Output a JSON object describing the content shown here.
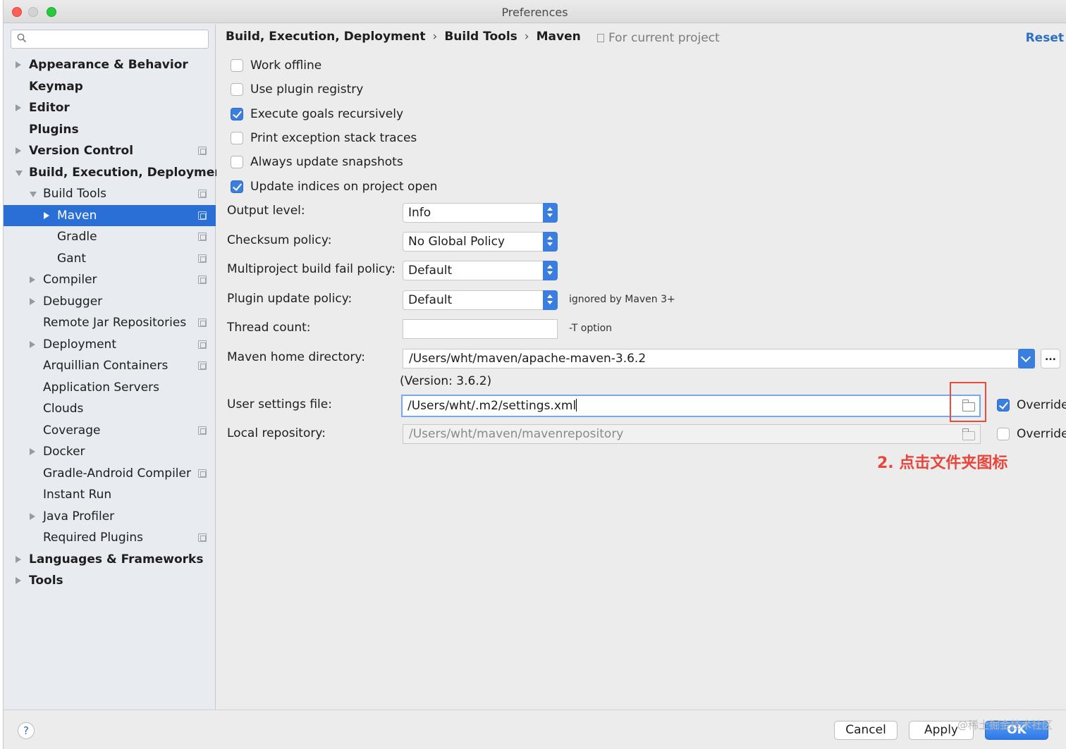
{
  "window": {
    "title": "Preferences"
  },
  "search": {
    "placeholder": ""
  },
  "sidebar": {
    "items": [
      {
        "label": "Appearance & Behavior",
        "bold": true,
        "arrow": "right",
        "indent": 0,
        "copy": false
      },
      {
        "label": "Keymap",
        "bold": true,
        "arrow": "none",
        "indent": 0,
        "copy": false
      },
      {
        "label": "Editor",
        "bold": true,
        "arrow": "right",
        "indent": 0,
        "copy": false
      },
      {
        "label": "Plugins",
        "bold": true,
        "arrow": "none",
        "indent": 0,
        "copy": false
      },
      {
        "label": "Version Control",
        "bold": true,
        "arrow": "right",
        "indent": 0,
        "copy": true
      },
      {
        "label": "Build, Execution, Deployment",
        "bold": true,
        "arrow": "down",
        "indent": 0,
        "copy": false
      },
      {
        "label": "Build Tools",
        "bold": false,
        "arrow": "down",
        "indent": 1,
        "copy": true
      },
      {
        "label": "Maven",
        "bold": false,
        "arrow": "right",
        "indent": 2,
        "copy": true,
        "selected": true
      },
      {
        "label": "Gradle",
        "bold": false,
        "arrow": "none",
        "indent": 2,
        "copy": true
      },
      {
        "label": "Gant",
        "bold": false,
        "arrow": "none",
        "indent": 2,
        "copy": true
      },
      {
        "label": "Compiler",
        "bold": false,
        "arrow": "right",
        "indent": 1,
        "copy": true
      },
      {
        "label": "Debugger",
        "bold": false,
        "arrow": "right",
        "indent": 1,
        "copy": false
      },
      {
        "label": "Remote Jar Repositories",
        "bold": false,
        "arrow": "none",
        "indent": 1,
        "copy": true
      },
      {
        "label": "Deployment",
        "bold": false,
        "arrow": "right",
        "indent": 1,
        "copy": true
      },
      {
        "label": "Arquillian Containers",
        "bold": false,
        "arrow": "none",
        "indent": 1,
        "copy": true
      },
      {
        "label": "Application Servers",
        "bold": false,
        "arrow": "none",
        "indent": 1,
        "copy": false
      },
      {
        "label": "Clouds",
        "bold": false,
        "arrow": "none",
        "indent": 1,
        "copy": false
      },
      {
        "label": "Coverage",
        "bold": false,
        "arrow": "none",
        "indent": 1,
        "copy": true
      },
      {
        "label": "Docker",
        "bold": false,
        "arrow": "right",
        "indent": 1,
        "copy": false
      },
      {
        "label": "Gradle-Android Compiler",
        "bold": false,
        "arrow": "none",
        "indent": 1,
        "copy": true
      },
      {
        "label": "Instant Run",
        "bold": false,
        "arrow": "none",
        "indent": 1,
        "copy": false
      },
      {
        "label": "Java Profiler",
        "bold": false,
        "arrow": "right",
        "indent": 1,
        "copy": false
      },
      {
        "label": "Required Plugins",
        "bold": false,
        "arrow": "none",
        "indent": 1,
        "copy": true
      },
      {
        "label": "Languages & Frameworks",
        "bold": true,
        "arrow": "right",
        "indent": 0,
        "copy": false
      },
      {
        "label": "Tools",
        "bold": true,
        "arrow": "right",
        "indent": 0,
        "copy": false
      }
    ]
  },
  "header": {
    "crumb1": "Build, Execution, Deployment",
    "crumb2": "Build Tools",
    "crumb3": "Maven",
    "separator": "›",
    "scope": "For current project",
    "reset": "Reset"
  },
  "checkboxes": [
    {
      "label": "Work offline",
      "checked": false
    },
    {
      "label": "Use plugin registry",
      "checked": false
    },
    {
      "label": "Execute goals recursively",
      "checked": true
    },
    {
      "label": "Print exception stack traces",
      "checked": false
    },
    {
      "label": "Always update snapshots",
      "checked": false
    },
    {
      "label": "Update indices on project open",
      "checked": true
    }
  ],
  "fields": {
    "output_level": {
      "label": "Output level:",
      "value": "Info"
    },
    "checksum_policy": {
      "label": "Checksum policy:",
      "value": "No Global Policy"
    },
    "fail_policy": {
      "label": "Multiproject build fail policy:",
      "value": "Default"
    },
    "plugin_update": {
      "label": "Plugin update policy:",
      "value": "Default",
      "hint": "ignored by Maven 3+"
    },
    "thread_count": {
      "label": "Thread count:",
      "value": "",
      "hint": "-T option"
    },
    "maven_home": {
      "label": "Maven home directory:",
      "value": "/Users/wht/maven/apache-maven-3.6.2",
      "version": "(Version: 3.6.2)",
      "more": "..."
    },
    "user_settings": {
      "label": "User settings file:",
      "value": "/Users/wht/.m2/settings.xml",
      "override_label": "Override",
      "override": true
    },
    "local_repo": {
      "label": "Local repository:",
      "value": "/Users/wht/maven/mavenrepository",
      "override_label": "Override",
      "override": false
    }
  },
  "annotation": "2. 点击文件夹图标",
  "buttons": {
    "help": "?",
    "cancel": "Cancel",
    "apply": "Apply",
    "ok": "OK"
  },
  "footer_watermark": "@稀土掘金技术社区",
  "colors": {
    "accent": "#3a7fe0",
    "selection": "#2a6fd6",
    "annotation": "#e8453c",
    "link": "#2d6fc4"
  }
}
